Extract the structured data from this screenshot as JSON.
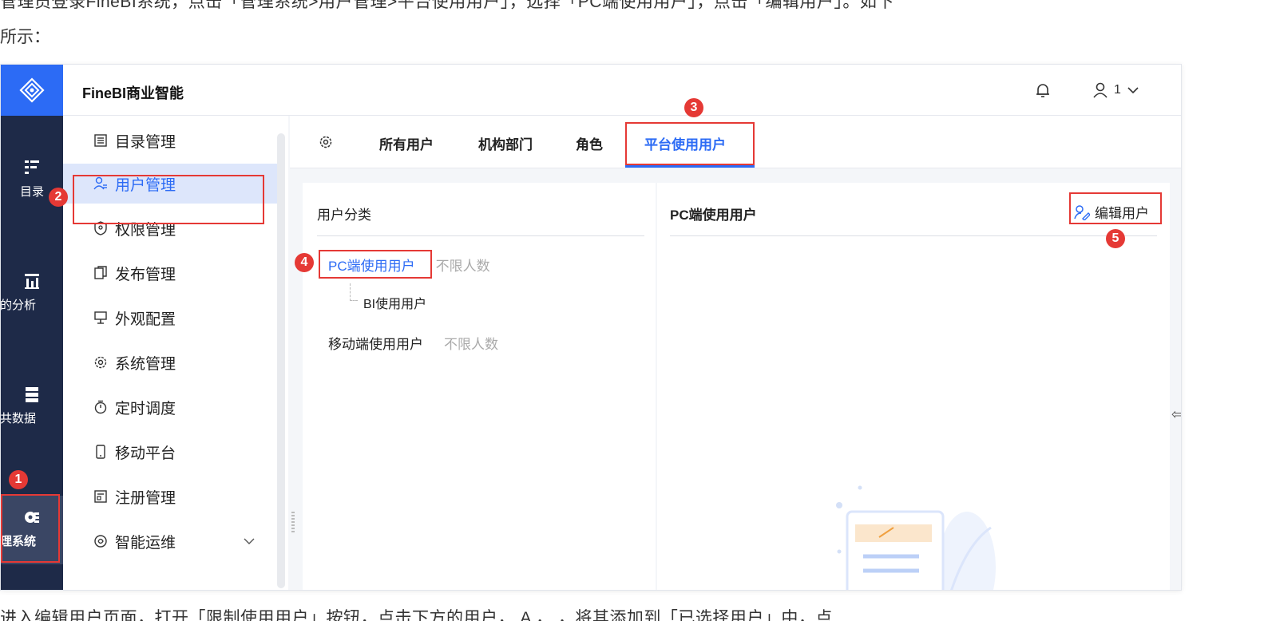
{
  "doc": {
    "intro_line": "管理员登录FineBI系统，点击「管理系统>用户管理>平台使用用户」，选择「PC端使用用户」，点击「编辑用户」。如下",
    "intro_line2": "所示：",
    "outro_line": "进入编辑用户页面，打开「限制使用用户」按钮，点击下方的用户，          A         ，          ，将其添加到「已选择用户」中，点"
  },
  "app": {
    "title": "FineBI商业智能",
    "user_label": "1",
    "logo_icon": "fineb-logo-icon"
  },
  "nav": {
    "items": [
      {
        "label": "目录",
        "icon": "catalog-icon"
      },
      {
        "label": "我的分析",
        "icon": "analysis-icon"
      },
      {
        "label": "公共数据",
        "icon": "data-icon"
      },
      {
        "label": "管理系统",
        "icon": "gear-icon"
      }
    ]
  },
  "menu": {
    "items": [
      {
        "label": "目录管理",
        "icon": "list-icon"
      },
      {
        "label": "用户管理",
        "icon": "users-icon"
      },
      {
        "label": "权限管理",
        "icon": "shield-icon"
      },
      {
        "label": "发布管理",
        "icon": "copy-icon"
      },
      {
        "label": "外观配置",
        "icon": "palette-icon"
      },
      {
        "label": "系统管理",
        "icon": "gear-icon"
      },
      {
        "label": "定时调度",
        "icon": "timer-icon"
      },
      {
        "label": "移动平台",
        "icon": "phone-icon"
      },
      {
        "label": "注册管理",
        "icon": "register-icon"
      },
      {
        "label": "智能运维",
        "icon": "ops-icon"
      }
    ]
  },
  "tabs": {
    "items": [
      "所有用户",
      "机构部门",
      "角色",
      "平台使用用户"
    ]
  },
  "left_panel": {
    "title": "用户分类",
    "tree": [
      {
        "label": "PC端使用用户",
        "count": "不限人数"
      },
      {
        "label": "BI使用用户"
      },
      {
        "label": "移动端使用用户",
        "count": "不限人数"
      }
    ]
  },
  "right_panel": {
    "title": "PC端使用用户",
    "edit_label": "编辑用户"
  },
  "annotations": {
    "badges": [
      "1",
      "2",
      "3",
      "4",
      "5"
    ]
  },
  "colors": {
    "primary": "#2c6bf5",
    "nav_bg": "#1e2a48",
    "annotation": "#e53935"
  }
}
